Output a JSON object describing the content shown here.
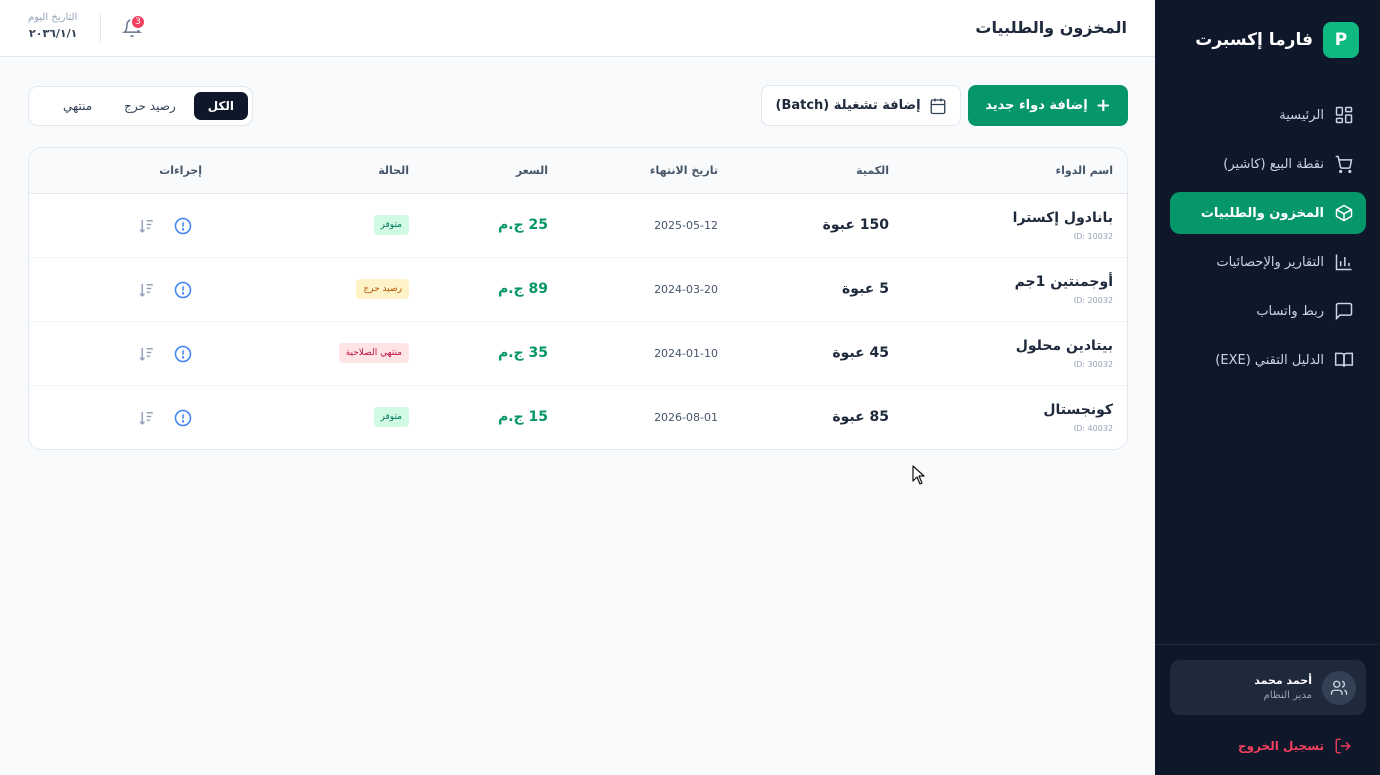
{
  "brand": {
    "logo_letter": "P",
    "name": "فارما إكسبرت"
  },
  "sidebar": {
    "items": [
      {
        "label": "الرئيسية",
        "icon": "dashboard-icon"
      },
      {
        "label": "نقطة البيع (كاشير)",
        "icon": "cart-icon"
      },
      {
        "label": "المخزون والطلبيات",
        "icon": "box-icon",
        "active": true
      },
      {
        "label": "التقارير والإحصائيات",
        "icon": "chart-icon"
      },
      {
        "label": "ربط واتساب",
        "icon": "message-icon"
      },
      {
        "label": "الدليل التقني (EXE)",
        "icon": "book-icon"
      }
    ],
    "user": {
      "name": "أحمد محمد",
      "role": "مدير النظام"
    },
    "logout_label": "تسجيل الخروج"
  },
  "header": {
    "title": "المخزون والطلبيات",
    "date_label": "التاريخ اليوم",
    "date_value": "٢٠٣٦/١/١",
    "notifications_count": "3"
  },
  "toolbar": {
    "add_drug_label": "إضافة دواء جديد",
    "add_batch_label": "إضافة تشغيلة (Batch)",
    "filters": [
      "الكل",
      "رصيد حرج",
      "منتهي"
    ],
    "active_filter": "الكل"
  },
  "table": {
    "columns": {
      "name": "اسم الدواء",
      "quantity": "الكمية",
      "expiry": "تاريخ الانتهاء",
      "price": "السعر",
      "status": "الحالة",
      "actions": "إجراءات"
    },
    "rows": [
      {
        "name": "بانادول إكسترا",
        "id": "ID: 10032",
        "quantity": "150 عبوة",
        "expiry": "2025-05-12",
        "price": "25 ج.م",
        "status": "متوفر",
        "status_type": "ok"
      },
      {
        "name": "أوجمنتين 1جم",
        "id": "ID: 20032",
        "quantity": "5 عبوة",
        "expiry": "2024-03-20",
        "price": "89 ج.م",
        "status": "رصيد حرج",
        "status_type": "low"
      },
      {
        "name": "بيتادين محلول",
        "id": "ID: 30032",
        "quantity": "45 عبوة",
        "expiry": "2024-01-10",
        "price": "35 ج.م",
        "status": "منتهي الصلاحية",
        "status_type": "expired"
      },
      {
        "name": "كونجستال",
        "id": "ID: 40032",
        "quantity": "85 عبوة",
        "expiry": "2026-08-01",
        "price": "15 ج.م",
        "status": "متوفر",
        "status_type": "ok"
      }
    ]
  },
  "colors": {
    "sidebar_bg": "#0f172a",
    "accent": "#059669",
    "danger": "#f43f5e"
  }
}
